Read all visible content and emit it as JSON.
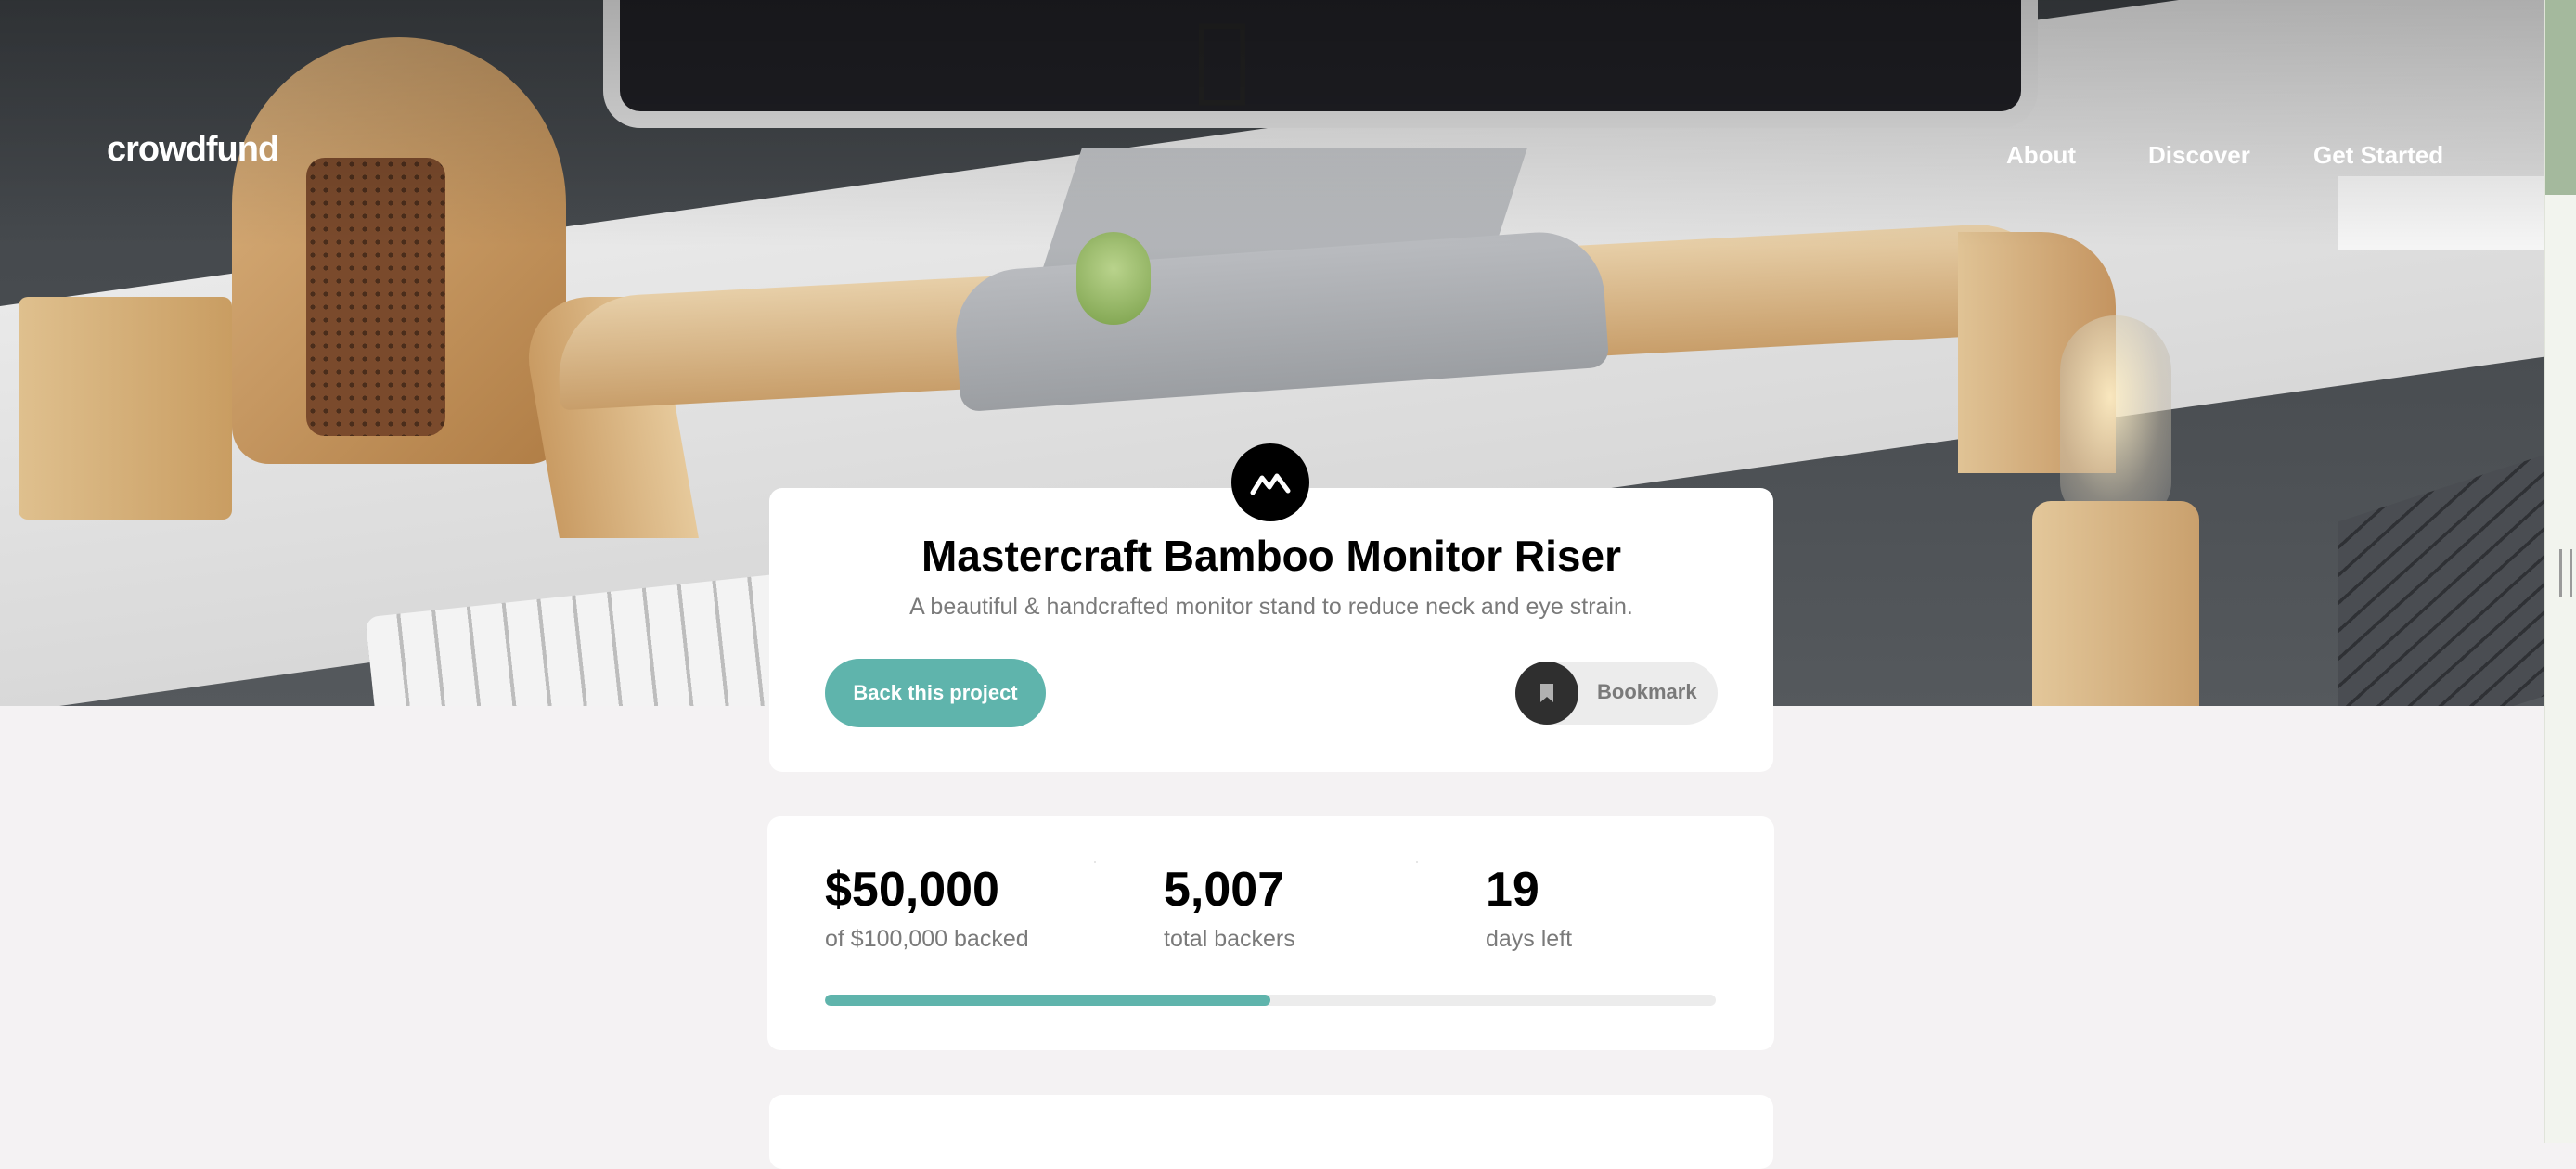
{
  "header": {
    "logo": "crowdfund",
    "nav": [
      "About",
      "Discover",
      "Get Started"
    ]
  },
  "project": {
    "title": "Mastercraft Bamboo Monitor Riser",
    "subtitle": "A beautiful & handcrafted monitor stand to reduce neck and eye strain.",
    "back_label": "Back this project",
    "bookmark_label": "Bookmark",
    "logo_icon": "mastercraft-logo-icon"
  },
  "stats": [
    {
      "value": "$50,000",
      "label": "of $100,000 backed"
    },
    {
      "value": "5,007",
      "label": "total backers"
    },
    {
      "value": "19",
      "label": "days left"
    }
  ],
  "progress": {
    "fraction": 0.5
  },
  "colors": {
    "accent": "#5fb4ac",
    "page_bg": "#f4f2f3",
    "card_bg": "#ffffff",
    "muted_text": "#7a7a7a",
    "dark": "#2f2f2f"
  }
}
